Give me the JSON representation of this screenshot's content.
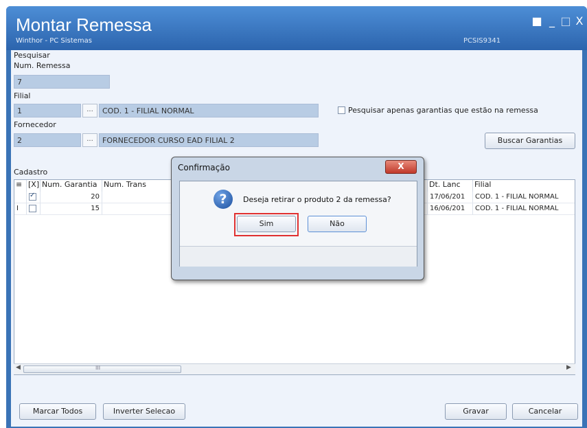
{
  "window": {
    "title": "Montar Remessa",
    "subtitle": "Winthor - PC Sistemas",
    "routine_code": "PCSIS9341",
    "controls": {
      "minimize": "_",
      "maximize": "□",
      "close": "X"
    }
  },
  "search": {
    "group_label": "Pesquisar",
    "num_remessa_label": "Num. Remessa",
    "num_remessa_value": "7",
    "filial_label": "Filial",
    "filial_code": "1",
    "filial_desc": "COD. 1 - FILIAL NORMAL",
    "fornecedor_label": "Fornecedor",
    "fornecedor_code": "2",
    "fornecedor_desc": "FORNECEDOR CURSO EAD FILIAL 2",
    "lookup_label": "...",
    "only_in_remessa_label": "Pesquisar apenas garantias que estão na remessa",
    "only_in_remessa_checked": false,
    "buscar_label": "Buscar Garantias"
  },
  "cadastro": {
    "group_label": "Cadastro",
    "columns": [
      "[X]",
      "Num. Garantia",
      "Num. Trans",
      "Dt. Lanc",
      "Filial"
    ],
    "rows": [
      {
        "marker": "",
        "checked": true,
        "num_garantia": "20",
        "num_trans": "",
        "dt_lanc": "17/06/201",
        "filial": "COD. 1 - FILIAL NORMAL"
      },
      {
        "marker": "I",
        "checked": false,
        "num_garantia": "15",
        "num_trans": "",
        "dt_lanc": "16/06/201",
        "filial": "COD. 1 - FILIAL NORMAL"
      }
    ],
    "scroll_label": "III"
  },
  "footer": {
    "marcar_todos": "Marcar Todos",
    "inverter_selecao": "Inverter Selecao",
    "gravar": "Gravar",
    "cancelar": "Cancelar"
  },
  "dialog": {
    "title": "Confirmação",
    "message": "Deseja retirar o produto 2 da remessa?",
    "icon": "question-icon",
    "yes_label": "Sim",
    "no_label": "Não",
    "close_label": "X",
    "highlight_color": "#e03030"
  },
  "colors": {
    "titlebar": "#3a73b6",
    "field_bg": "#b8cce4",
    "client_bg": "#eef3fb"
  }
}
